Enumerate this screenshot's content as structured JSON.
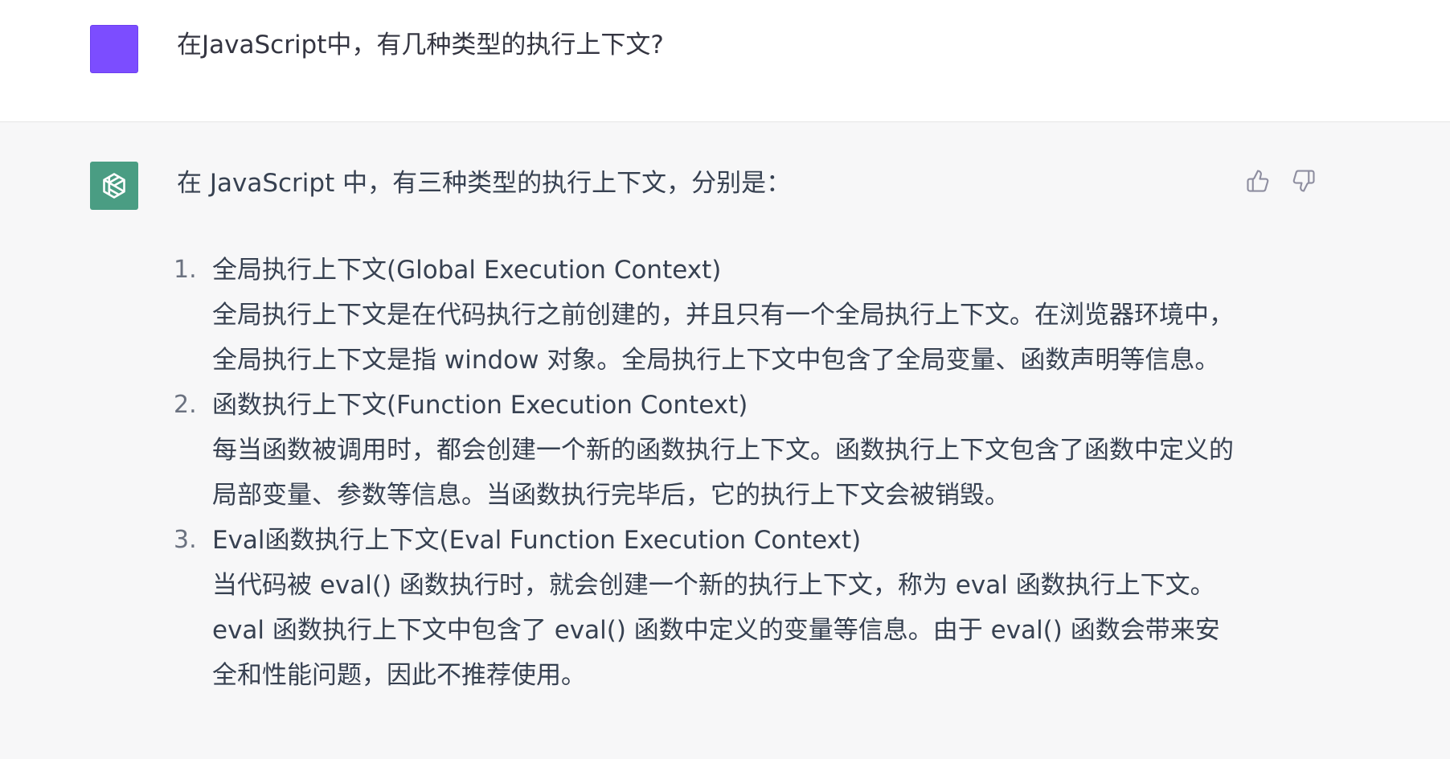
{
  "user": {
    "avatar_color": "#7c4dff",
    "message": "在JavaScript中，有几种类型的执行上下文?"
  },
  "assistant": {
    "avatar_color": "#4a9d83",
    "avatar_icon": "openai-logo-icon",
    "intro": "在 JavaScript 中，有三种类型的执行上下文，分别是：",
    "items": [
      {
        "number": "1.",
        "title": "全局执行上下文(Global Execution Context)",
        "body": "全局执行上下文是在代码执行之前创建的，并且只有一个全局执行上下文。在浏览器环境中，全局执行上下文是指 window 对象。全局执行上下文中包含了全局变量、函数声明等信息。"
      },
      {
        "number": "2.",
        "title": "函数执行上下文(Function Execution Context)",
        "body": "每当函数被调用时，都会创建一个新的函数执行上下文。函数执行上下文包含了函数中定义的局部变量、参数等信息。当函数执行完毕后，它的执行上下文会被销毁。"
      },
      {
        "number": "3.",
        "title": "Eval函数执行上下文(Eval Function Execution Context)",
        "body": "当代码被 eval() 函数执行时，就会创建一个新的执行上下文，称为 eval 函数执行上下文。eval 函数执行上下文中包含了 eval() 函数中定义的变量等信息。由于 eval() 函数会带来安全和性能问题，因此不推荐使用。"
      }
    ],
    "feedback": {
      "thumbs_up_icon": "thumbs-up-icon",
      "thumbs_down_icon": "thumbs-down-icon"
    }
  }
}
